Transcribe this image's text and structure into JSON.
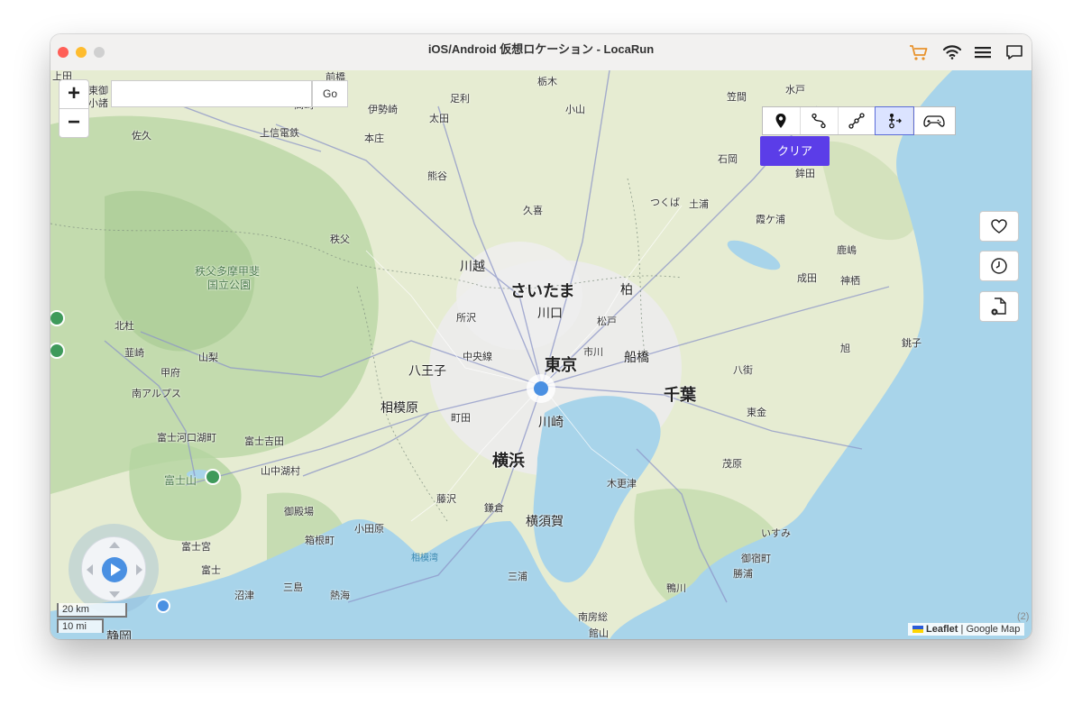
{
  "window": {
    "title": "iOS/Android 仮想ロケーション - LocaRun"
  },
  "toolbar_icons": [
    "cart-icon",
    "wifi-icon",
    "menu-icon",
    "chat-icon"
  ],
  "colors": {
    "accent": "#5b3de8",
    "cart": "#e8922b",
    "location_dot": "#4a90e2",
    "sea": "#a8d4ea",
    "land": "#e6ecd2",
    "forest": "#bcd8a8"
  },
  "map_controls": {
    "zoom_in": "+",
    "zoom_out": "−",
    "search_placeholder": "",
    "search_go": "Go"
  },
  "mode_bar": {
    "modes": [
      "teleport-mode-icon",
      "two-spot-mode-icon",
      "multi-spot-mode-icon",
      "jump-teleport-mode-icon",
      "joystick-mode-icon"
    ],
    "active_index": 3,
    "clear_label": "クリア"
  },
  "side_buttons": [
    "favorite-icon",
    "history-icon",
    "import-gpx-icon"
  ],
  "scale": {
    "km": "20 km",
    "mi": "10 mi"
  },
  "attribution": {
    "leaflet": "Leaflet",
    "separator": "|",
    "provider": "Google Map"
  },
  "corner_text": "(2)",
  "map_labels": {
    "top": [
      "上田",
      "東御",
      "小諸",
      "前橋",
      "高崎",
      "伊勢崎",
      "足利",
      "太田",
      "栃木",
      "小山",
      "水戸",
      "笠間",
      "佐久",
      "上信電鉄",
      "本庄",
      "熊谷",
      "石岡",
      "鉾田"
    ],
    "mid": [
      "つくば",
      "土浦",
      "霞ケ浦",
      "久喜",
      "秩父",
      "鹿嶋",
      "川越",
      "さいたま",
      "柏",
      "成田",
      "神栖",
      "秩父多摩甲斐",
      "国立公園",
      "所沢",
      "川口",
      "松戸",
      "北杜",
      "韮崎",
      "山梨",
      "中央線",
      "東京",
      "市川",
      "船橋",
      "旭",
      "銚子",
      "甲府",
      "八王子",
      "八街",
      "南アルプス",
      "千葉",
      "相模原",
      "町田",
      "川崎",
      "東金"
    ],
    "bottom": [
      "富士河口湖町",
      "富士吉田",
      "横浜",
      "山中湖村",
      "富士山",
      "茂原",
      "木更津",
      "藤沢",
      "鎌倉",
      "御殿場",
      "横須賀",
      "いすみ",
      "小田原",
      "箱根町",
      "相模湾",
      "富士宮",
      "御宿町",
      "富士",
      "勝浦",
      "三浦",
      "沼津",
      "三島",
      "熱海",
      "鴨川",
      "南房総",
      "館山",
      "静岡"
    ]
  }
}
